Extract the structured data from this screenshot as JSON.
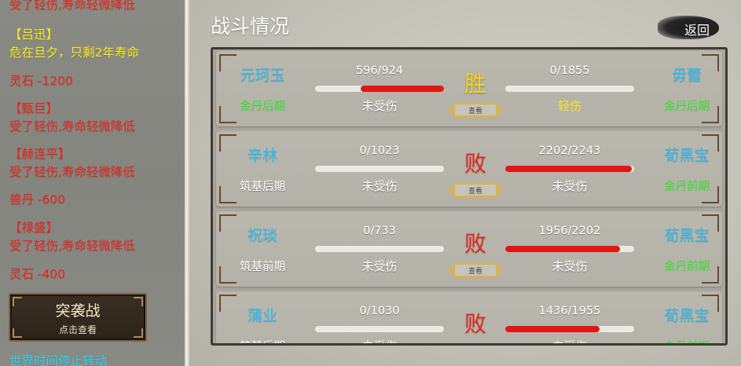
{
  "log": [
    {
      "text": "受了轻伤,寿命轻微降低",
      "color": "red"
    },
    {
      "text": "【吕迅】",
      "color": "yellow"
    },
    {
      "text": "危在旦夕，只剩2年寿命",
      "color": "yellow"
    },
    {
      "text": "灵石 -1200",
      "color": "red"
    },
    {
      "text": "【甄巨】",
      "color": "red"
    },
    {
      "text": "受了轻伤,寿命轻微降低",
      "color": "red"
    },
    {
      "text": "【赫连平】",
      "color": "red"
    },
    {
      "text": "受了轻伤,寿命轻微降低",
      "color": "red"
    },
    {
      "text": "兽丹 -600",
      "color": "red"
    },
    {
      "text": "【禄盛】",
      "color": "red"
    },
    {
      "text": "受了轻伤,寿命轻微降低",
      "color": "red"
    },
    {
      "text": "灵石 -400",
      "color": "red"
    }
  ],
  "raid_button": {
    "title": "突袭战",
    "subtitle": "点击查看"
  },
  "world_status": "世界时间停止转动",
  "title": "战斗情况",
  "back_label": "返回",
  "view_label": "查看",
  "battles": [
    {
      "left": {
        "name": "元珂玉",
        "realm": "金丹后期",
        "realm_color": "green",
        "hp": "596/924",
        "hp_fraction": 0.645,
        "status": "未受伤",
        "status_color": "white"
      },
      "result": "胜",
      "result_type": "win",
      "right": {
        "name": "毋蕾",
        "realm": "金丹后期",
        "realm_color": "green",
        "hp": "0/1855",
        "hp_fraction": 0.0,
        "status": "轻伤",
        "status_color": "yellow"
      }
    },
    {
      "left": {
        "name": "辛林",
        "realm": "筑基后期",
        "realm_color": "white",
        "hp": "0/1023",
        "hp_fraction": 0.0,
        "status": "未受伤",
        "status_color": "white"
      },
      "result": "败",
      "result_type": "lose",
      "right": {
        "name": "荀黑宝",
        "realm": "金丹前期",
        "realm_color": "green",
        "hp": "2202/2243",
        "hp_fraction": 0.982,
        "status": "未受伤",
        "status_color": "white"
      }
    },
    {
      "left": {
        "name": "祝琰",
        "realm": "筑基前期",
        "realm_color": "white",
        "hp": "0/733",
        "hp_fraction": 0.0,
        "status": "未受伤",
        "status_color": "white"
      },
      "result": "败",
      "result_type": "lose",
      "right": {
        "name": "荀黑宝",
        "realm": "金丹前期",
        "realm_color": "green",
        "hp": "1956/2202",
        "hp_fraction": 0.888,
        "status": "未受伤",
        "status_color": "white"
      }
    },
    {
      "left": {
        "name": "蒲业",
        "realm": "筑基后期",
        "realm_color": "white",
        "hp": "0/1030",
        "hp_fraction": 0.0,
        "status": "未受伤",
        "status_color": "white"
      },
      "result": "败",
      "result_type": "lose",
      "right": {
        "name": "荀黑宝",
        "realm": "金丹前期",
        "realm_color": "green",
        "hp": "1436/1955",
        "hp_fraction": 0.734,
        "status": "未受伤",
        "status_color": "white"
      }
    }
  ]
}
